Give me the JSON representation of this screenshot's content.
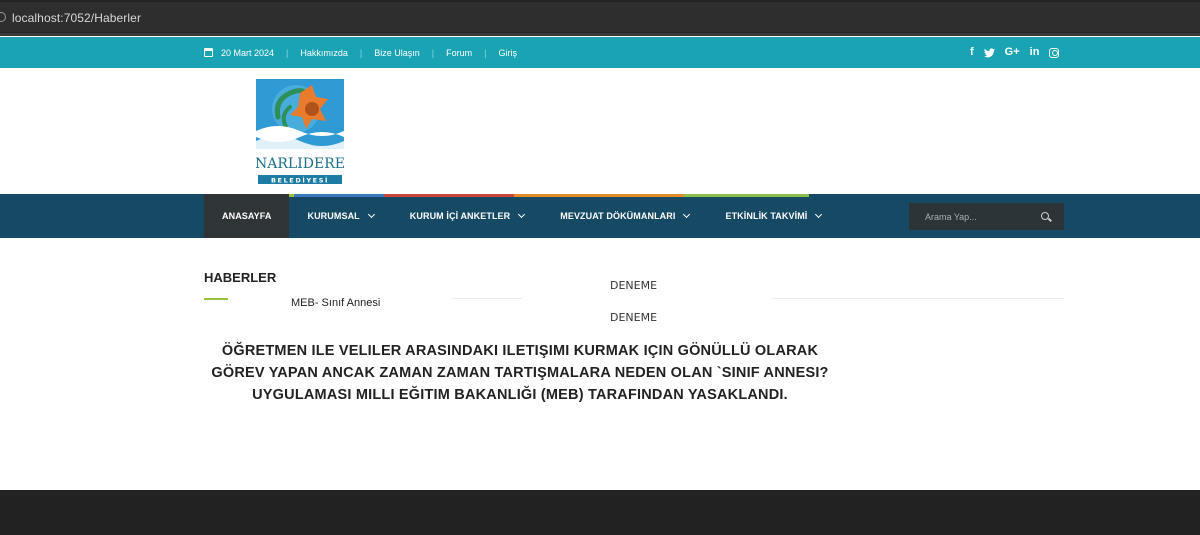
{
  "browser": {
    "url": "localhost:7052/Haberler"
  },
  "topbar": {
    "date": "20 Mart 2024",
    "links": [
      "Hakkımızda",
      "Bize Ulaşın",
      "Forum",
      "Giriş"
    ],
    "social": [
      "facebook-icon",
      "twitter-icon",
      "google-plus-icon",
      "linkedin-icon",
      "instagram-icon"
    ],
    "social_glyphs": [
      "f",
      "🐦",
      "G+",
      "in"
    ]
  },
  "logo": {
    "line1": "NARLIDERE",
    "line2": "BELEDİYESİ"
  },
  "nav": {
    "items": [
      {
        "label": "ANASAYFA",
        "active": true,
        "dropdown": false
      },
      {
        "label": "KURUMSAL",
        "active": false,
        "dropdown": true
      },
      {
        "label": "KURUM İÇİ ANKETLER",
        "active": false,
        "dropdown": true
      },
      {
        "label": "MEVZUAT DÖKÜMANLARI",
        "active": false,
        "dropdown": true
      },
      {
        "label": "ETKİNLİK TAKVİMİ",
        "active": false,
        "dropdown": true
      }
    ],
    "search_placeholder": "Arama Yap..."
  },
  "content": {
    "section_title": "HABERLER",
    "news_link": "MEB- Sınıf Annesi",
    "tab_1": "DENEME",
    "tab_2": "DENEME",
    "headline": "ÖĞRETMEN ILE VELILER ARASINDAKI ILETIŞIMI KURMAK IÇIN GÖNÜLLÜ OLARAK GÖREV YAPAN ANCAK ZAMAN ZAMAN TARTIŞMALARA NEDEN OLAN `SINIF ANNESI? UYGULAMASI MILLI EĞITIM BAKANLIĞI (MEB) TARAFINDAN YASAKLANDI."
  },
  "colors": {
    "topbar": "#1aa3b3",
    "navbar": "#164a64",
    "nav_active": "#2f3437",
    "accent_green": "#9ac23c",
    "footer": "#222222"
  }
}
